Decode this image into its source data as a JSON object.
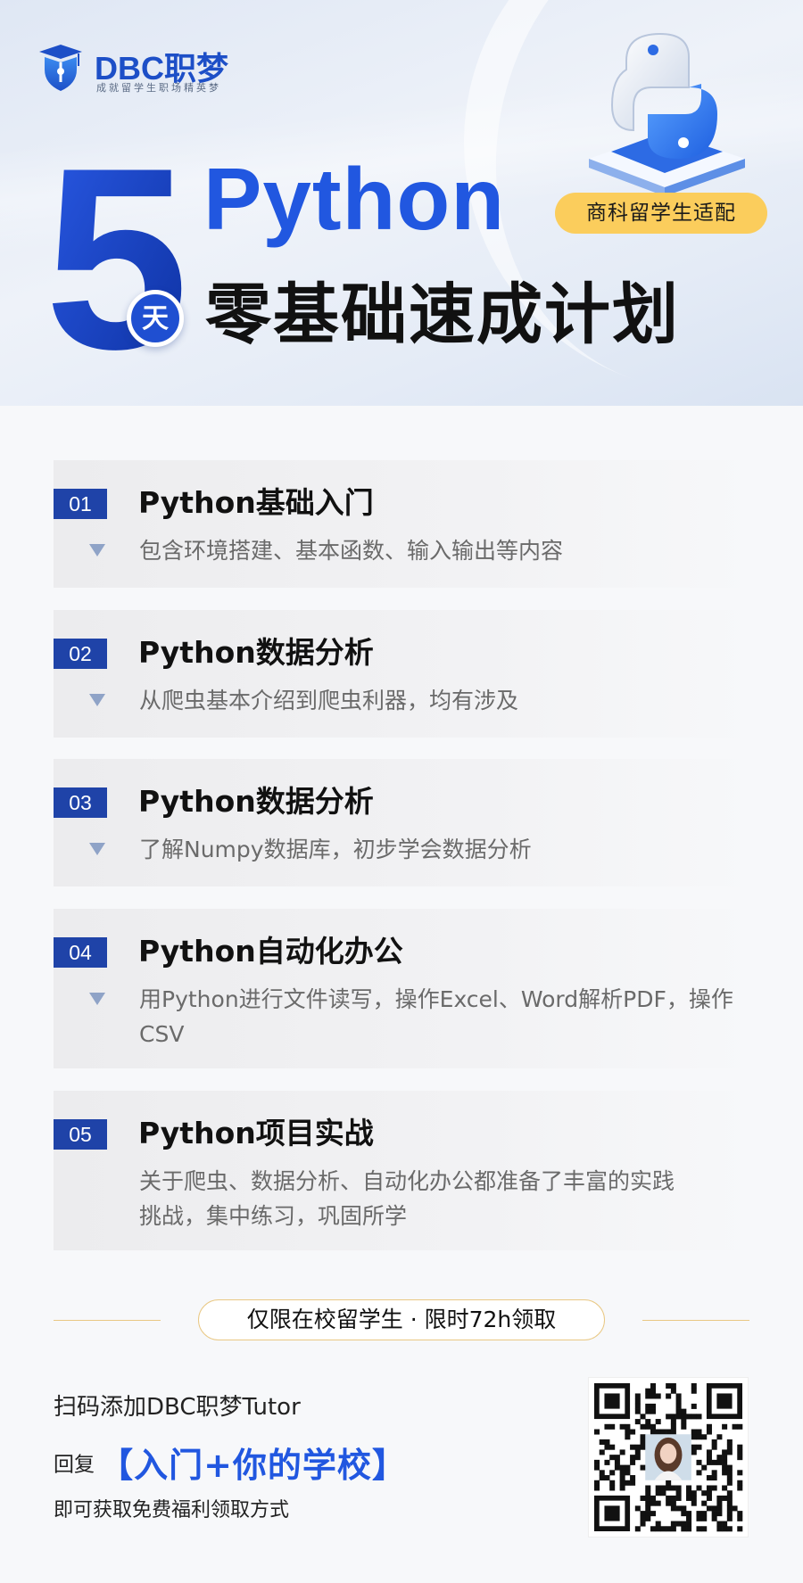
{
  "brand": {
    "name": "DBC职梦",
    "slogan": "成就留学生职场精英梦"
  },
  "hero": {
    "big_number": "5",
    "day_unit": "天",
    "title": "Python",
    "subtitle": "零基础速成计划",
    "tag": "商科留学生适配"
  },
  "courses": [
    {
      "num": "01",
      "title": "Python基础入门",
      "desc": "包含环境搭建、基本函数、输入输出等内容"
    },
    {
      "num": "02",
      "title": "Python数据分析",
      "desc": "从爬虫基本介绍到爬虫利器，均有涉及"
    },
    {
      "num": "03",
      "title": "Python数据分析",
      "desc": "了解Numpy数据库，初步学会数据分析"
    },
    {
      "num": "04",
      "title": "Python自动化办公",
      "desc": "用Python进行文件读写，操作Excel、Word解析PDF，操作CSV"
    },
    {
      "num": "05",
      "title": "Python项目实战",
      "desc": "关于爬虫、数据分析、自动化办公都准备了丰富的实践挑战，集中练习，巩固所学"
    }
  ],
  "offer": {
    "text": "仅限在校留学生 · 限时72h领取"
  },
  "cta": {
    "line1": "扫码添加DBC职梦Tutor",
    "prefix": "回复",
    "keyword": "【入门+你的学校】",
    "line3": "即可获取免费福利领取方式"
  },
  "colors": {
    "primary": "#2157e0",
    "number_badge": "#1f43a8",
    "tag_yellow": "#fbcd5c",
    "gold_line": "#e9c884"
  }
}
